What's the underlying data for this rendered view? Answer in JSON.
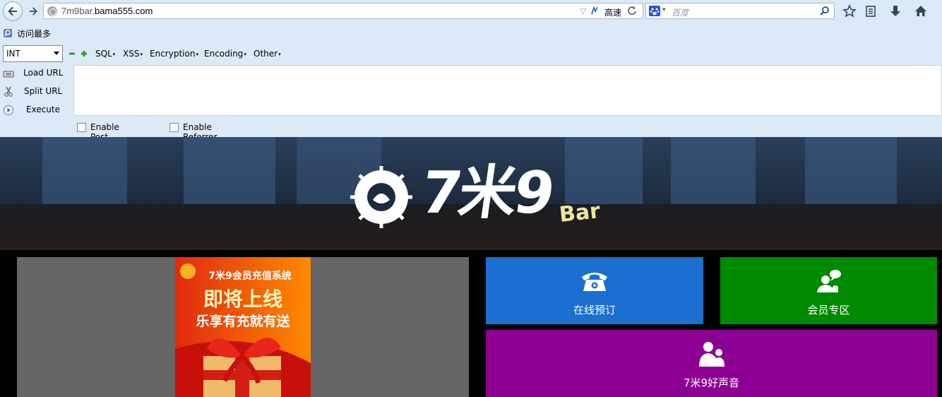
{
  "browser": {
    "url_prefix": "7m9bar.",
    "url_domain": "bama555.com",
    "speed_label": "高速",
    "search_placeholder": "百度",
    "bookmark_label": "访问最多"
  },
  "hackbar": {
    "select_value": "INT",
    "menus": [
      "SQL",
      "XSS",
      "Encryption",
      "Encoding",
      "Other"
    ],
    "actions": [
      "Load URL",
      "Split URL",
      "Execute"
    ],
    "options": [
      "Enable Post data",
      "Enable Referrer"
    ]
  },
  "page": {
    "logo_main": "7米9",
    "logo_sub": "Bar",
    "promo": {
      "line1": "7米9会员充值系统",
      "line2": "即将上线",
      "line3": "乐享有充就有送"
    },
    "tiles": [
      {
        "label": "在线预订",
        "icon": "telephone-icon",
        "color": "#1a6fd0"
      },
      {
        "label": "会员专区",
        "icon": "member-chat-icon",
        "color": "#008a00"
      },
      {
        "label": "7米9好声音",
        "icon": "people-icon",
        "color": "#8d0093"
      }
    ]
  }
}
